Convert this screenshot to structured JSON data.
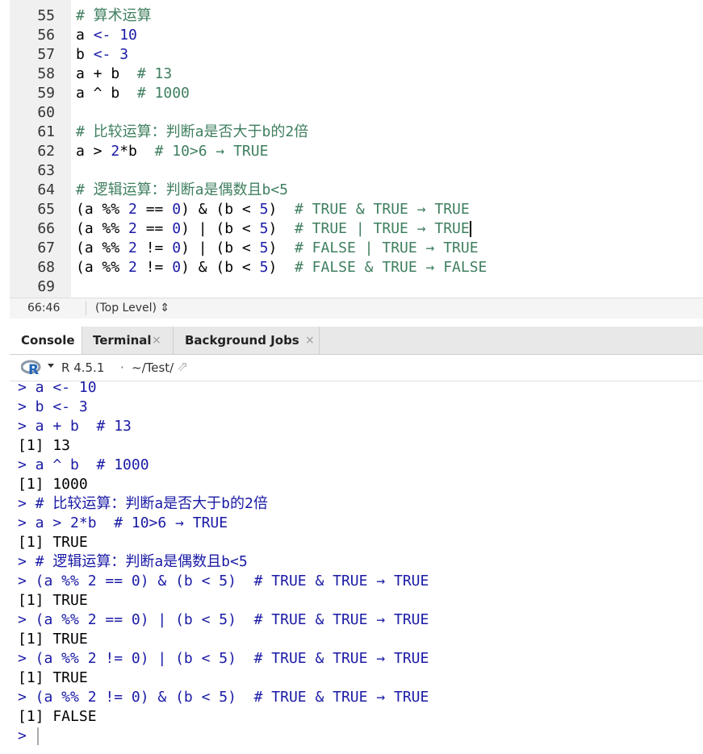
{
  "editor": {
    "lines": [
      {
        "num": "55",
        "parts": [
          {
            "t": "# 算术运算",
            "c": "cmt"
          }
        ]
      },
      {
        "num": "56",
        "parts": [
          {
            "t": "a ",
            "c": "ident"
          },
          {
            "t": "<- ",
            "c": "kw"
          },
          {
            "t": "10",
            "c": "num"
          }
        ]
      },
      {
        "num": "57",
        "parts": [
          {
            "t": "b ",
            "c": "ident"
          },
          {
            "t": "<- ",
            "c": "kw"
          },
          {
            "t": "3",
            "c": "num"
          }
        ]
      },
      {
        "num": "58",
        "parts": [
          {
            "t": "a + b  ",
            "c": "ident"
          },
          {
            "t": "# 13",
            "c": "cmt"
          }
        ]
      },
      {
        "num": "59",
        "parts": [
          {
            "t": "a ^ b  ",
            "c": "ident"
          },
          {
            "t": "# 1000",
            "c": "cmt"
          }
        ]
      },
      {
        "num": "60",
        "parts": []
      },
      {
        "num": "61",
        "parts": [
          {
            "t": "# 比较运算：判断a是否大于b的2倍",
            "c": "cmt"
          }
        ]
      },
      {
        "num": "62",
        "parts": [
          {
            "t": "a > ",
            "c": "ident"
          },
          {
            "t": "2",
            "c": "num"
          },
          {
            "t": "*b  ",
            "c": "ident"
          },
          {
            "t": "# 10>6 → TRUE",
            "c": "cmt"
          }
        ]
      },
      {
        "num": "63",
        "parts": []
      },
      {
        "num": "64",
        "parts": [
          {
            "t": "# 逻辑运算：判断a是偶数且b<5",
            "c": "cmt"
          }
        ]
      },
      {
        "num": "65",
        "parts": [
          {
            "t": "(a %% ",
            "c": "ident"
          },
          {
            "t": "2",
            "c": "num"
          },
          {
            "t": " == ",
            "c": "ident"
          },
          {
            "t": "0",
            "c": "num"
          },
          {
            "t": ") & (b < ",
            "c": "ident"
          },
          {
            "t": "5",
            "c": "num"
          },
          {
            "t": ")  ",
            "c": "ident"
          },
          {
            "t": "# TRUE & TRUE → TRUE",
            "c": "cmt"
          }
        ]
      },
      {
        "num": "66",
        "parts": [
          {
            "t": "(a %% ",
            "c": "ident"
          },
          {
            "t": "2",
            "c": "num"
          },
          {
            "t": " == ",
            "c": "ident"
          },
          {
            "t": "0",
            "c": "num"
          },
          {
            "t": ") | (b < ",
            "c": "ident"
          },
          {
            "t": "5",
            "c": "num"
          },
          {
            "t": ")  ",
            "c": "ident"
          },
          {
            "t": "# TRUE | TRUE → TRUE",
            "c": "cmt"
          }
        ],
        "cursor": true
      },
      {
        "num": "67",
        "parts": [
          {
            "t": "(a %% ",
            "c": "ident"
          },
          {
            "t": "2",
            "c": "num"
          },
          {
            "t": " != ",
            "c": "ident"
          },
          {
            "t": "0",
            "c": "num"
          },
          {
            "t": ") | (b < ",
            "c": "ident"
          },
          {
            "t": "5",
            "c": "num"
          },
          {
            "t": ")  ",
            "c": "ident"
          },
          {
            "t": "# FALSE | TRUE → TRUE",
            "c": "cmt"
          }
        ]
      },
      {
        "num": "68",
        "parts": [
          {
            "t": "(a %% ",
            "c": "ident"
          },
          {
            "t": "2",
            "c": "num"
          },
          {
            "t": " != ",
            "c": "ident"
          },
          {
            "t": "0",
            "c": "num"
          },
          {
            "t": ") & (b < ",
            "c": "ident"
          },
          {
            "t": "5",
            "c": "num"
          },
          {
            "t": ")  ",
            "c": "ident"
          },
          {
            "t": "# FALSE & TRUE → FALSE",
            "c": "cmt"
          }
        ]
      },
      {
        "num": "69",
        "parts": []
      }
    ]
  },
  "statusbar": {
    "position": "66:46",
    "scope": "(Top Level) ⇕"
  },
  "tabs": {
    "console": "Console",
    "terminal": "Terminal",
    "background_jobs": "Background Jobs",
    "close_glyph": "×"
  },
  "console_header": {
    "r_version": "R 4.5.1",
    "separator": "·",
    "path": "~/Test/",
    "arrow": "⇗"
  },
  "console": {
    "lines": [
      {
        "type": "input",
        "text": "> a <- 10"
      },
      {
        "type": "input",
        "text": "> b <- 3"
      },
      {
        "type": "input",
        "text": "> a + b  # 13"
      },
      {
        "type": "output",
        "text": "[1] 13"
      },
      {
        "type": "input",
        "text": "> a ^ b  # 1000"
      },
      {
        "type": "output",
        "text": "[1] 1000"
      },
      {
        "type": "input",
        "text": "> # 比较运算：判断a是否大于b的2倍"
      },
      {
        "type": "input",
        "text": "> a > 2*b  # 10>6 → TRUE"
      },
      {
        "type": "output",
        "text": "[1] TRUE"
      },
      {
        "type": "input",
        "text": "> # 逻辑运算：判断a是偶数且b<5"
      },
      {
        "type": "input",
        "text": "> (a %% 2 == 0) & (b < 5)  # TRUE & TRUE → TRUE"
      },
      {
        "type": "output",
        "text": "[1] TRUE"
      },
      {
        "type": "input",
        "text": "> (a %% 2 == 0) | (b < 5)  # TRUE & TRUE → TRUE"
      },
      {
        "type": "output",
        "text": "[1] TRUE"
      },
      {
        "type": "input",
        "text": "> (a %% 2 != 0) | (b < 5)  # TRUE & TRUE → TRUE"
      },
      {
        "type": "output",
        "text": "[1] TRUE"
      },
      {
        "type": "input",
        "text": "> (a %% 2 != 0) & (b < 5)  # TRUE & TRUE → TRUE"
      },
      {
        "type": "output",
        "text": "[1] FALSE"
      },
      {
        "type": "input",
        "text": ">"
      }
    ]
  }
}
